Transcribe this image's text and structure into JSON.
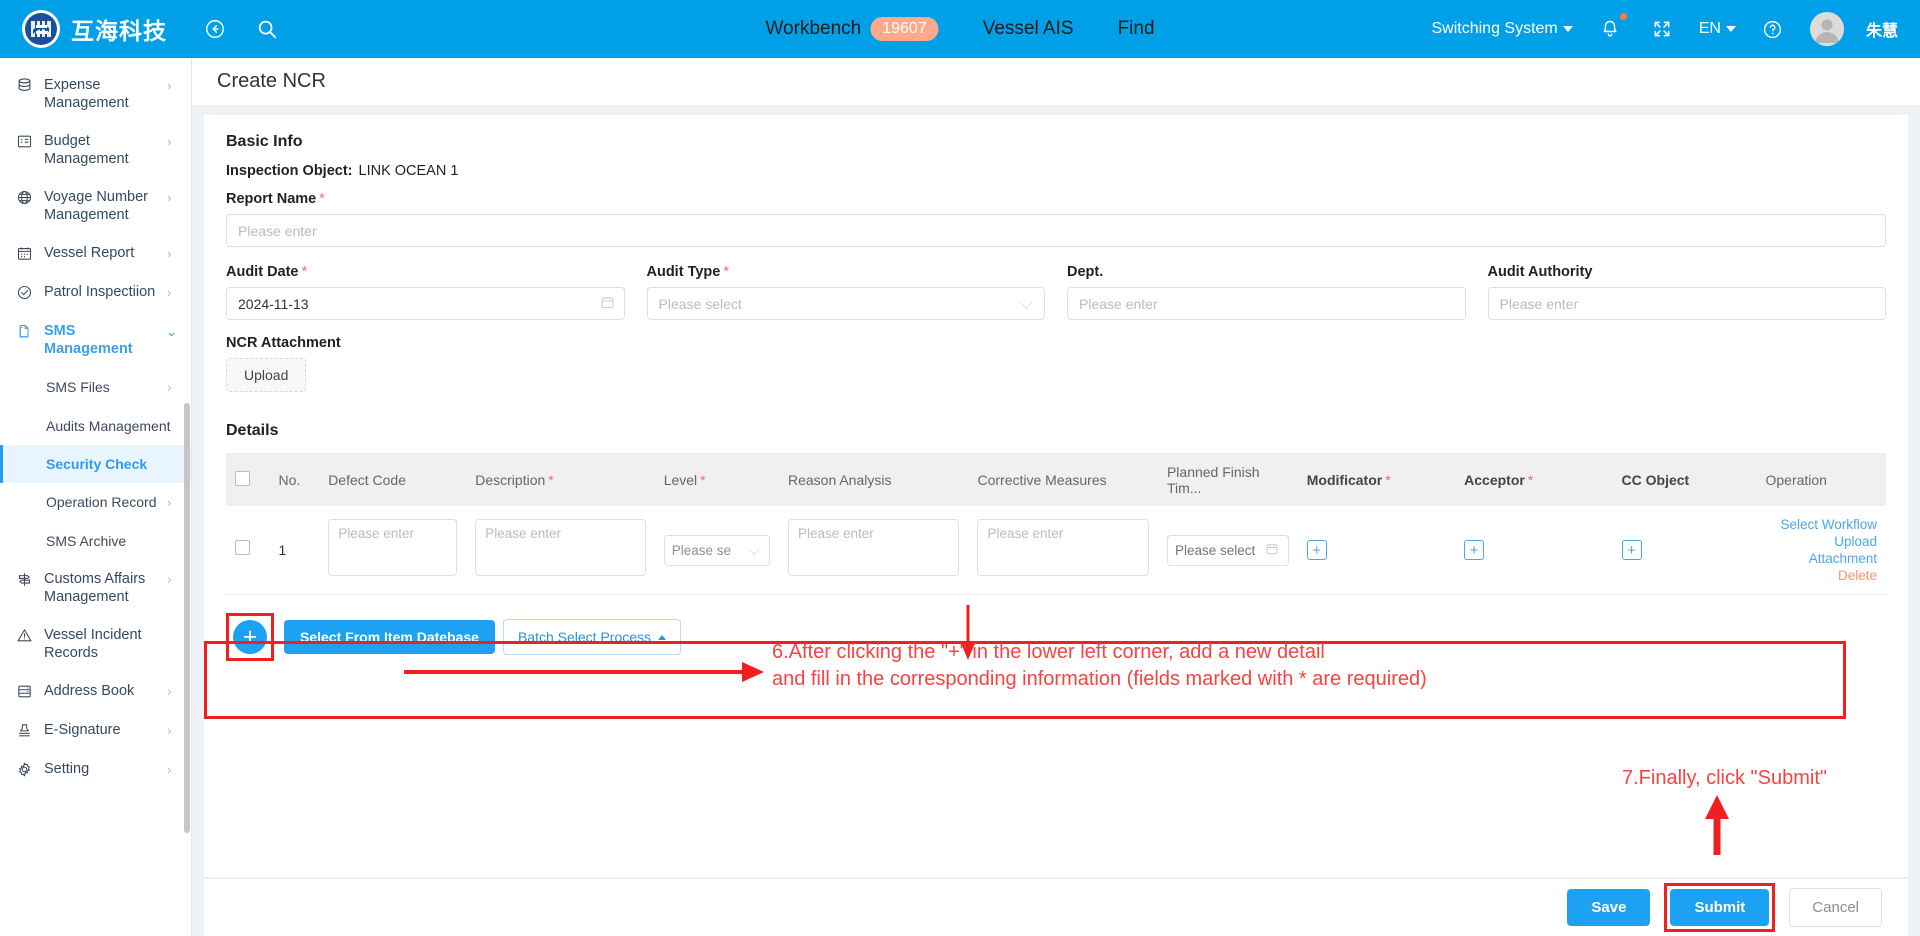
{
  "header": {
    "brand_name": "互海科技",
    "collapse_icon": "collapse-left-icon",
    "search_icon": "search-icon",
    "nav": [
      {
        "label": "Workbench",
        "badge": "19607"
      },
      {
        "label": "Vessel AIS",
        "badge": ""
      },
      {
        "label": "Find",
        "badge": ""
      }
    ],
    "switch_system": "Switching System",
    "bell_icon": "notification-bell-icon",
    "fullscreen_icon": "fullscreen-icon",
    "language": "EN",
    "help_icon": "help-circle-icon",
    "user_name": "朱慧",
    "accent_color": "#00a0e9",
    "badge_color": "#ffa98a"
  },
  "sidebar": {
    "items": [
      {
        "label": "Expense Management",
        "icon": "database-icon",
        "arrow": true,
        "level": 0,
        "state": ""
      },
      {
        "label": "Budget Management",
        "icon": "budget-grid-icon",
        "arrow": true,
        "level": 0,
        "state": ""
      },
      {
        "label": "Voyage Number Management",
        "icon": "globe-icon",
        "arrow": true,
        "level": 0,
        "state": ""
      },
      {
        "label": "Vessel Report",
        "icon": "calendar-icon",
        "arrow": true,
        "level": 0,
        "state": ""
      },
      {
        "label": "Patrol Inspectiion",
        "icon": "check-circle-icon",
        "arrow": true,
        "level": 0,
        "state": ""
      },
      {
        "label": "SMS Management",
        "icon": "documents-icon",
        "arrow": true,
        "level": 0,
        "state": "expanded"
      },
      {
        "label": "SMS Files",
        "icon": "",
        "arrow": true,
        "level": 1,
        "state": ""
      },
      {
        "label": "Audits Management",
        "icon": "",
        "arrow": false,
        "level": 1,
        "state": ""
      },
      {
        "label": "Security Check",
        "icon": "",
        "arrow": false,
        "level": 1,
        "state": "active"
      },
      {
        "label": "Operation Record",
        "icon": "",
        "arrow": true,
        "level": 1,
        "state": ""
      },
      {
        "label": "SMS Archive",
        "icon": "",
        "arrow": false,
        "level": 1,
        "state": ""
      },
      {
        "label": "Customs Affairs Management",
        "icon": "signpost-icon",
        "arrow": true,
        "level": 0,
        "state": ""
      },
      {
        "label": "Vessel Incident Records",
        "icon": "warning-triangle-icon",
        "arrow": false,
        "level": 0,
        "state": ""
      },
      {
        "label": "Address Book",
        "icon": "address-book-icon",
        "arrow": true,
        "level": 0,
        "state": ""
      },
      {
        "label": "E-Signature",
        "icon": "stamp-icon",
        "arrow": true,
        "level": 0,
        "state": ""
      },
      {
        "label": "Setting",
        "icon": "gear-icon",
        "arrow": true,
        "level": 0,
        "state": ""
      }
    ]
  },
  "page": {
    "title": "Create NCR"
  },
  "basic_info": {
    "section_title": "Basic Info",
    "inspection_object_label": "Inspection Object:",
    "inspection_object_value": "LINK OCEAN 1",
    "report_name_label": "Report Name",
    "report_name_placeholder": "Please enter",
    "report_name_value": "",
    "audit_date_label": "Audit Date",
    "audit_date_value": "2024-11-13",
    "audit_type_label": "Audit Type",
    "audit_type_placeholder": "Please select",
    "dept_label": "Dept.",
    "dept_placeholder": "Please enter",
    "dept_value": "",
    "audit_authority_label": "Audit Authority",
    "audit_authority_placeholder": "Please enter",
    "audit_authority_value": "",
    "ncr_attachment_label": "NCR Attachment",
    "upload_label": "Upload"
  },
  "details": {
    "section_title": "Details",
    "columns": [
      {
        "label": "",
        "required": false,
        "bold": false
      },
      {
        "label": "No.",
        "required": false,
        "bold": false
      },
      {
        "label": "Defect Code",
        "required": false,
        "bold": false
      },
      {
        "label": "Description",
        "required": true,
        "bold": false
      },
      {
        "label": "Level",
        "required": true,
        "bold": false
      },
      {
        "label": "Reason Analysis",
        "required": false,
        "bold": false
      },
      {
        "label": "Corrective Measures",
        "required": false,
        "bold": false
      },
      {
        "label": "Planned Finish Tim...",
        "required": false,
        "bold": false
      },
      {
        "label": "Modificator",
        "required": true,
        "bold": true
      },
      {
        "label": "Acceptor",
        "required": true,
        "bold": true
      },
      {
        "label": "CC Object",
        "required": false,
        "bold": true
      },
      {
        "label": "Operation",
        "required": false,
        "bold": false
      }
    ],
    "rows": [
      {
        "no": "1",
        "defect_code_placeholder": "Please enter",
        "description_placeholder": "Please enter",
        "level_placeholder": "Please se",
        "reason_analysis_placeholder": "Please enter",
        "corrective_measures_placeholder": "Please enter",
        "planned_finish_placeholder": "Please select",
        "modificator_add": "+",
        "acceptor_add": "+",
        "cc_object_add": "+",
        "op_select_workflow": "Select Workflow",
        "op_upload_attachment": "Upload Attachment",
        "op_delete": "Delete"
      }
    ],
    "add_row_button": "+",
    "select_from_item_db": "Select From Item Datebase",
    "batch_select_process": "Batch Select Process"
  },
  "annotations": [
    {
      "id": "step6",
      "line1": "6.After clicking the \"+\" in the lower left corner, add a new detail",
      "line2": "and fill in the corresponding information (fields marked with * are required)"
    },
    {
      "id": "step7",
      "text": "7.Finally, click \"Submit\""
    }
  ],
  "footer": {
    "save": "Save",
    "submit": "Submit",
    "cancel": "Cancel"
  },
  "colors": {
    "accent": "#00a0e9",
    "primary_button": "#1da1f2",
    "annotation_red": "#fa4242",
    "required_star": "#f56c6c",
    "link_blue": "#4aa8e8",
    "delete_orange": "#ff8f6e"
  }
}
